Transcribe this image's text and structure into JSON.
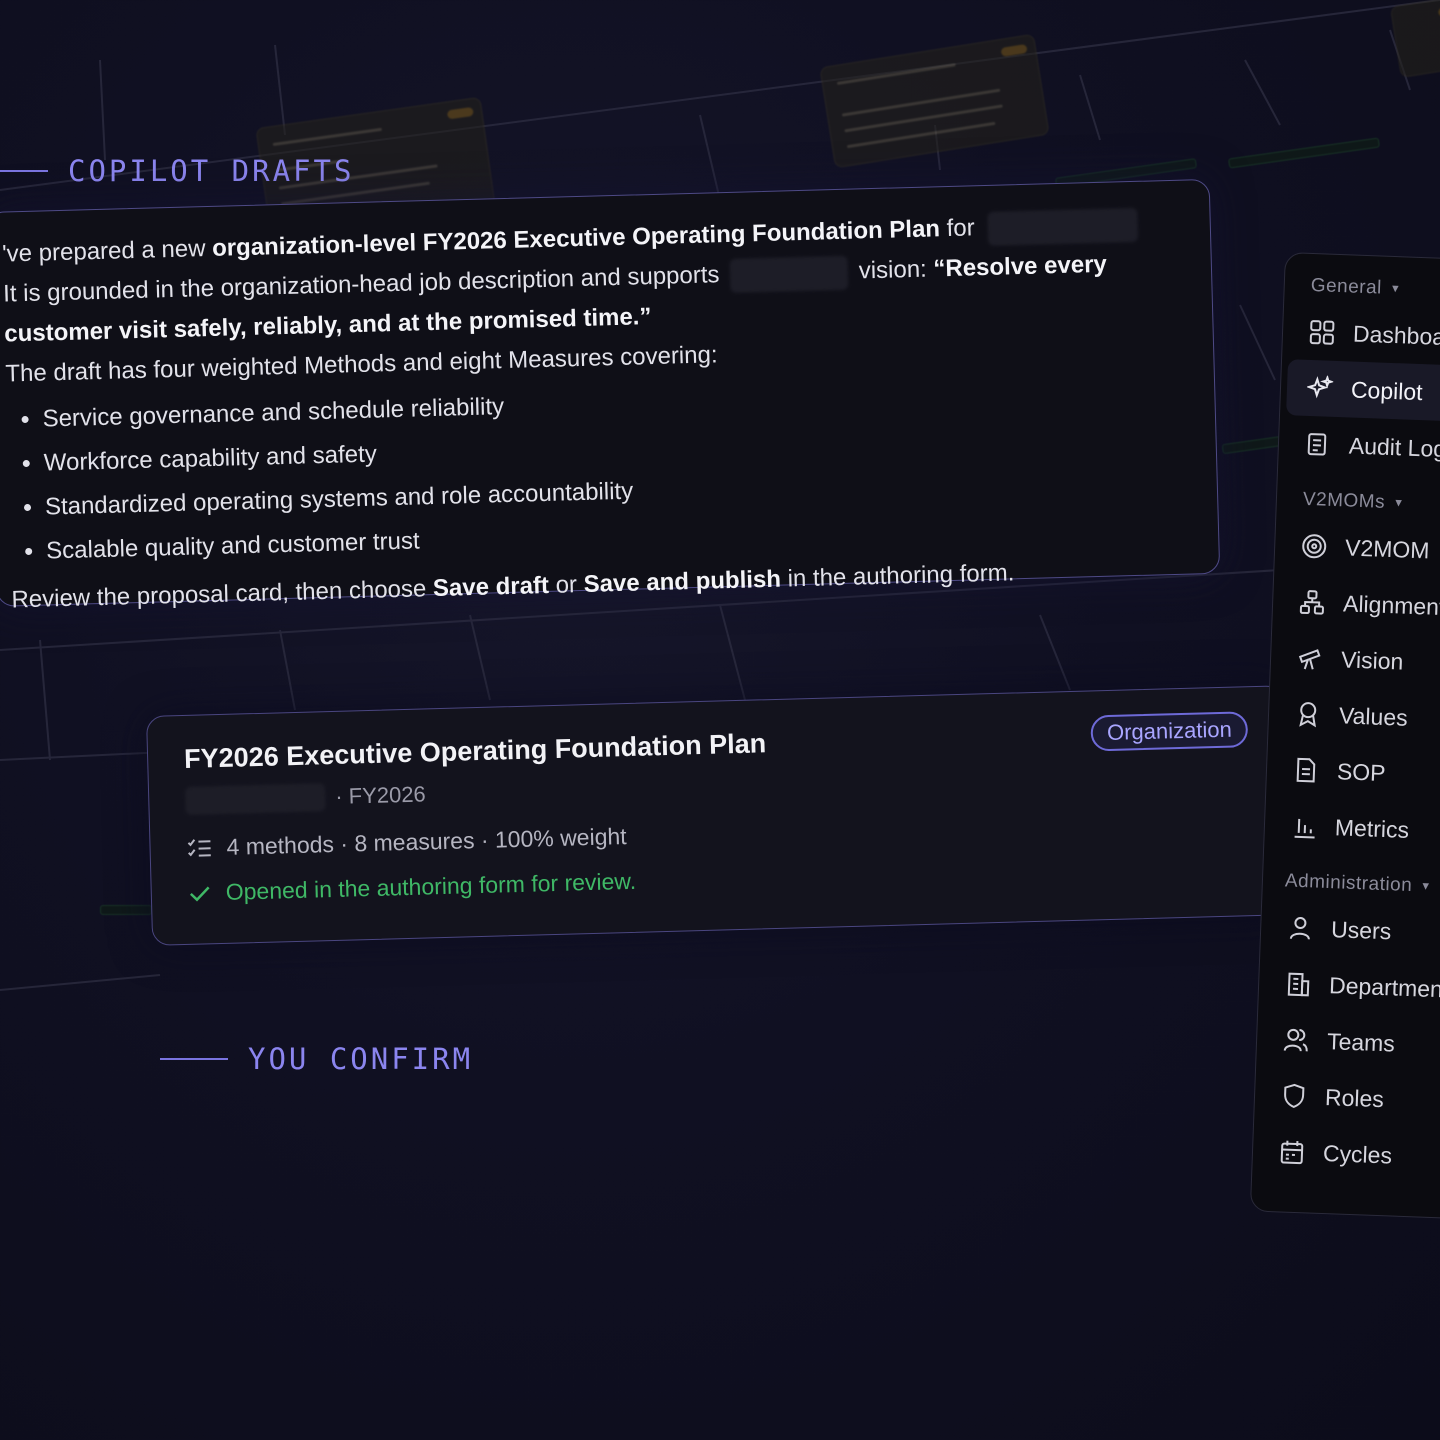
{
  "labels": {
    "drafts": "COPILOT DRAFTS",
    "confirm": "YOU CONFIRM"
  },
  "message": {
    "line1_a": "'ve prepared a new ",
    "line1_b": "organization-level FY2026 Executive Operating Foundation Plan",
    "line1_c": " for",
    "line2_a": "It is grounded in the organization-head job description and supports",
    "line2_b": "vision: ",
    "line2_c": "“Resolve every",
    "line3": "customer visit safely, reliably, and at the promised time.”",
    "line4": "The draft has four weighted Methods and eight Measures covering:",
    "bullets": [
      "Service governance and schedule reliability",
      "Workforce capability and safety",
      "Standardized operating systems and role accountability",
      "Scalable quality and customer trust"
    ],
    "closing_a": "Review the proposal card, then choose ",
    "closing_b": "Save draft",
    "closing_c": " or ",
    "closing_d": "Save and publish",
    "closing_e": " in the authoring form."
  },
  "proposal": {
    "title": "FY2026 Executive Operating Foundation Plan",
    "badge": "Organization",
    "period": "· FY2026",
    "stats": "4 methods · 8 measures · 100% weight",
    "status": "Opened in the authoring form for review.",
    "status_color": "#3fb866"
  },
  "sidebar": {
    "general_label": "General",
    "general_items": [
      {
        "label": "Dashboard",
        "icon": "dashboard-icon"
      },
      {
        "label": "Copilot",
        "icon": "sparkles-icon",
        "active": true
      },
      {
        "label": "Audit Log",
        "icon": "scroll-icon"
      }
    ],
    "v2mom_label": "V2MOMs",
    "v2mom_items": [
      {
        "label": "V2MOM",
        "icon": "target-icon"
      },
      {
        "label": "Alignment",
        "icon": "hierarchy-icon"
      },
      {
        "label": "Vision",
        "icon": "telescope-icon"
      },
      {
        "label": "Values",
        "icon": "award-icon"
      },
      {
        "label": "SOP",
        "icon": "document-icon"
      },
      {
        "label": "Metrics",
        "icon": "bar-chart-icon"
      }
    ],
    "admin_label": "Administration",
    "admin_items": [
      {
        "label": "Users",
        "icon": "user-icon"
      },
      {
        "label": "Departments",
        "icon": "building-icon"
      },
      {
        "label": "Teams",
        "icon": "users-icon"
      },
      {
        "label": "Roles",
        "icon": "shield-icon"
      },
      {
        "label": "Cycles",
        "icon": "calendar-icon"
      }
    ]
  },
  "colors": {
    "accent": "#8b85ef",
    "card_border": "#4e4a86",
    "success": "#3fb866"
  }
}
